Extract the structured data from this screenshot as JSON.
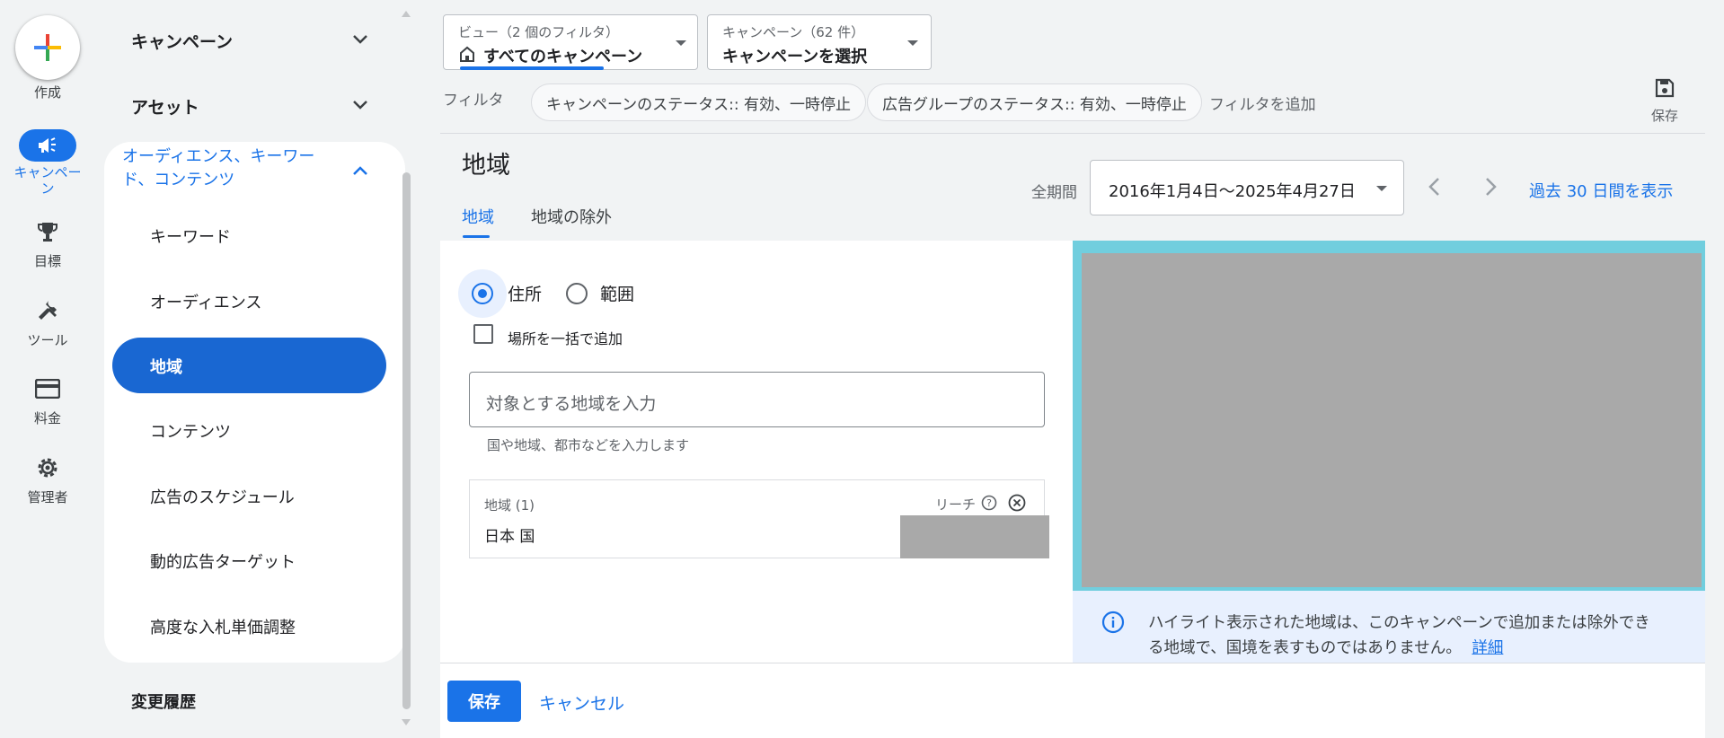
{
  "rail": {
    "create_label": "作成",
    "items": [
      {
        "label": "キャンペーン",
        "icon": "megaphone-icon",
        "active": true
      },
      {
        "label": "目標",
        "icon": "trophy-icon"
      },
      {
        "label": "ツール",
        "icon": "tools-icon"
      },
      {
        "label": "料金",
        "icon": "credit-card-icon"
      },
      {
        "label": "管理者",
        "icon": "gear-icon"
      }
    ]
  },
  "nav": {
    "campaigns": "キャンペーン",
    "assets": "アセット",
    "section_title": "オーディエンス、キーワード、コンテンツ",
    "sub_items": [
      "キーワード",
      "オーディエンス",
      "地域",
      "コンテンツ",
      "広告のスケジュール",
      "動的広告ターゲット",
      "高度な入札単価調整"
    ],
    "active_item": "地域",
    "history": "変更履歴"
  },
  "header": {
    "view": {
      "small": "ビュー（2 個のフィルタ）",
      "value": "すべてのキャンペーン"
    },
    "campaign": {
      "small": "キャンペーン（62 件）",
      "value": "キャンペーンを選択"
    },
    "filter_label": "フィルタ",
    "chips": [
      "キャンペーンのステータス:: 有効、一時停止",
      "広告グループのステータス:: 有効、一時停止"
    ],
    "add_filter": "フィルタを追加",
    "save_label": "保存"
  },
  "page": {
    "title": "地域",
    "tabs": [
      "地域",
      "地域の除外"
    ],
    "active_tab": "地域",
    "period_label": "全期間",
    "date_range": "2016年1月4日〜2025年4月27日",
    "last30": "過去 30 日間を表示"
  },
  "form": {
    "radio_address": "住所",
    "radio_radius": "範囲",
    "bulk_add": "場所を一括で追加",
    "input_placeholder": "対象とする地域を入力",
    "input_helper": "国や地域、都市などを入力します",
    "list_header": "地域 (1)",
    "reach_label": "リーチ",
    "location": "日本 国"
  },
  "map": {
    "info_text_1": "ハイライト表示された地域は、このキャンペーンで追加または除外でき",
    "info_text_2": "る地域で、国境を表すものではありません。",
    "info_link": "詳細"
  },
  "footer": {
    "save": "保存",
    "cancel": "キャンセル"
  },
  "colors": {
    "accent": "#1a73e8",
    "active_nav": "#1967d2",
    "map_water": "#71cede"
  }
}
